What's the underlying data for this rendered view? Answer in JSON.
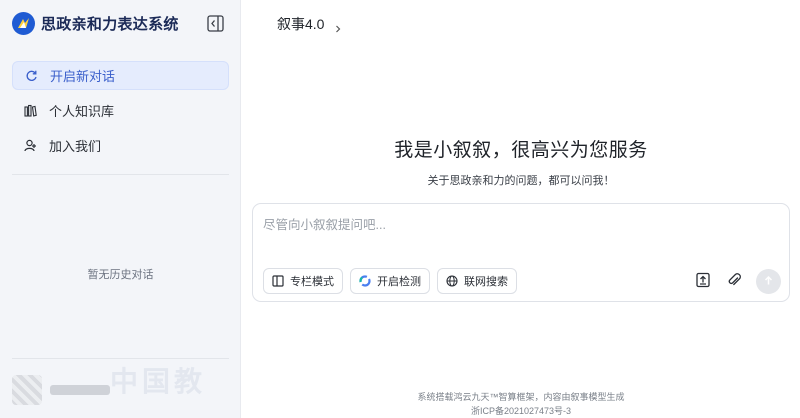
{
  "app": {
    "title": "思政亲和力表达系统"
  },
  "sidebar": {
    "collapse_icon": "sidebar-collapse-icon",
    "items": [
      {
        "label": "开启新对话",
        "icon": "refresh-icon",
        "active": true
      },
      {
        "label": "个人知识库",
        "icon": "library-icon",
        "active": false
      },
      {
        "label": "加入我们",
        "icon": "user-add-icon",
        "active": false
      }
    ],
    "empty_history": "暂无历史对话",
    "watermark": "中国教"
  },
  "main": {
    "model": "叙事4.0",
    "welcome_title": "我是小叙叙，很高兴为您服务",
    "welcome_subtitle": "关于思政亲和力的问题，都可以问我！",
    "composer": {
      "placeholder": "尽管向小叙叙提问吧...",
      "chips": [
        {
          "label": "专栏模式",
          "icon": "columns-icon"
        },
        {
          "label": "开启检测",
          "icon": "detect-icon"
        },
        {
          "label": "联网搜索",
          "icon": "globe-icon"
        }
      ]
    },
    "footer_line1": "系统搭载鸿云九天™智算框架，内容由叙事模型生成",
    "footer_line2": "浙ICP备2021027473号-3"
  },
  "colors": {
    "accent": "#3a5fcb",
    "brand": "#1f5bd3",
    "sidebar_bg": "#f3f5f9"
  }
}
